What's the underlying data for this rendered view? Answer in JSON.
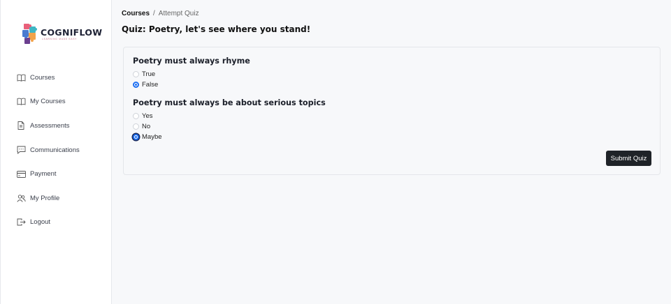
{
  "brand": {
    "name": "COGNIFLOW",
    "tagline": "LEARNING MADE EASY"
  },
  "sidebar": {
    "items": [
      {
        "label": "Courses",
        "icon": "book-open-icon"
      },
      {
        "label": "My Courses",
        "icon": "book-open-icon"
      },
      {
        "label": "Assessments",
        "icon": "document-icon"
      },
      {
        "label": "Communications",
        "icon": "chat-icon"
      },
      {
        "label": "Payment",
        "icon": "credit-card-icon"
      },
      {
        "label": "My Profile",
        "icon": "users-icon"
      },
      {
        "label": "Logout",
        "icon": "logout-icon"
      }
    ]
  },
  "breadcrumb": {
    "root": "Courses",
    "separator": "/",
    "current": "Attempt Quiz"
  },
  "page": {
    "title": "Quiz: Poetry, let's see where you stand!"
  },
  "quiz": {
    "questions": [
      {
        "title": "Poetry must always rhyme",
        "options": [
          "True",
          "False"
        ],
        "selected": "False"
      },
      {
        "title": "Poetry must always be about serious topics",
        "options": [
          "Yes",
          "No",
          "Maybe"
        ],
        "selected": "Maybe"
      }
    ],
    "submit_label": "Submit Quiz"
  },
  "colors": {
    "accent": "#1d6ff2",
    "button": "#1f2328",
    "background": "#f7f8fa"
  }
}
